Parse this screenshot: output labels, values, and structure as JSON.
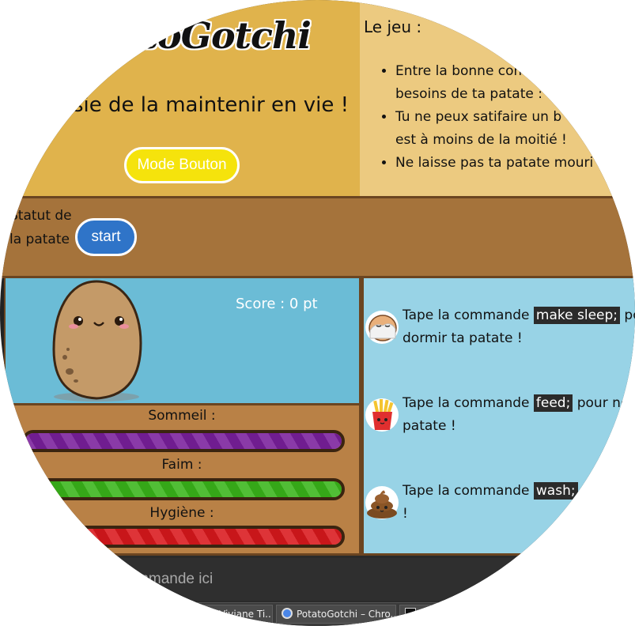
{
  "header": {
    "logo": "atoGotchi",
    "subtitle": "sie de la maintenir en vie !",
    "mode_button": "Mode Bouton"
  },
  "rules": {
    "title": "Le jeu :",
    "items": [
      {
        "line1": "Entre la bonne com",
        "line2": "besoins de ta patate :"
      },
      {
        "line1": "Tu ne peux satifaire un b",
        "line2": "est à moins de la moitié !"
      },
      {
        "line1": "Ne laisse pas ta patate mouri",
        "line2": ""
      }
    ]
  },
  "status": {
    "label_line1": "Statut de",
    "label_line2": "la patate",
    "start_button": "start"
  },
  "game": {
    "score": "Score : 0 pt"
  },
  "bars": [
    {
      "label": "Sommeil :",
      "level": 1.0,
      "color": "#7a1f9c"
    },
    {
      "label": "Faim :",
      "level": 1.0,
      "color": "#39b51a"
    },
    {
      "label": "Hygiène :",
      "level": 1.0,
      "color": "#d9181c"
    }
  ],
  "commands": [
    {
      "icon": "sleeping-potato-icon",
      "before": "Tape la commande ",
      "code": "make sleep;",
      "after": " pou",
      "line2": "dormir ta patate !"
    },
    {
      "icon": "fries-icon",
      "before": "Tape la commande ",
      "code": "feed;",
      "after": " pour no",
      "line2": "patate !"
    },
    {
      "icon": "poop-icon",
      "before": "Tape la commande ",
      "code": "wash;",
      "after": "",
      "line2": "!"
    }
  ],
  "input": {
    "placeholder": "commande ici"
  },
  "taskbar": {
    "tabs": [
      {
        "label": "Viviane Ti..."
      },
      {
        "label": "PotatoGotchi – Chro..."
      }
    ]
  }
}
